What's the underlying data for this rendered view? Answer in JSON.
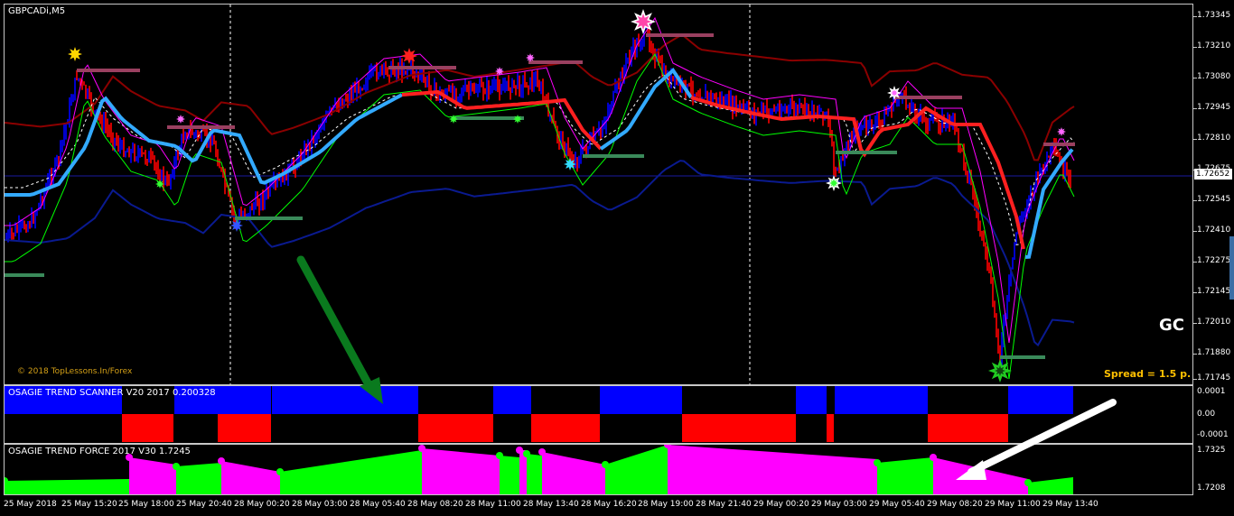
{
  "main_chart": {
    "title": "GBPCADi,M5",
    "copyright": "© 2018 TopLessons.In/Forex",
    "gc_label": "GC",
    "spread_label": "Spread = 1.5 p.",
    "current_price": "1.72652",
    "price_scale": [
      "1.73345",
      "1.73210",
      "1.73080",
      "1.72945",
      "1.72810",
      "1.72675",
      "1.72545",
      "1.72410",
      "1.72275",
      "1.72145",
      "1.72010",
      "1.71880",
      "1.71745"
    ]
  },
  "scanner": {
    "title": "OSAGIE TREND SCANNER V20 2017 0.200328",
    "scale": [
      "0.0001",
      "0.00",
      "-0.0001"
    ]
  },
  "force": {
    "title": "OSAGIE TREND FORCE 2017 V30 1.7245",
    "scale": [
      "1.7325",
      "1.7208"
    ]
  },
  "time_axis": [
    "25 May 2018",
    "25 May 15:20",
    "25 May 18:00",
    "25 May 20:40",
    "28 May 00:20",
    "28 May 03:00",
    "28 May 05:40",
    "28 May 08:20",
    "28 May 11:00",
    "28 May 13:40",
    "28 May 16:20",
    "28 May 19:00",
    "28 May 21:40",
    "29 May 00:20",
    "29 May 03:00",
    "29 May 05:40",
    "29 May 08:20",
    "29 May 11:00",
    "29 May 13:40"
  ],
  "colors": {
    "up": "#0000ff",
    "down": "#ff0000",
    "force_up": "#00ff00",
    "force_down": "#ff00ff",
    "arrow_green": "#0a7a1e",
    "arrow_white": "#ffffff"
  },
  "icons": [
    "star-signal-icon",
    "green-arrow-icon",
    "white-arrow-icon"
  ]
}
